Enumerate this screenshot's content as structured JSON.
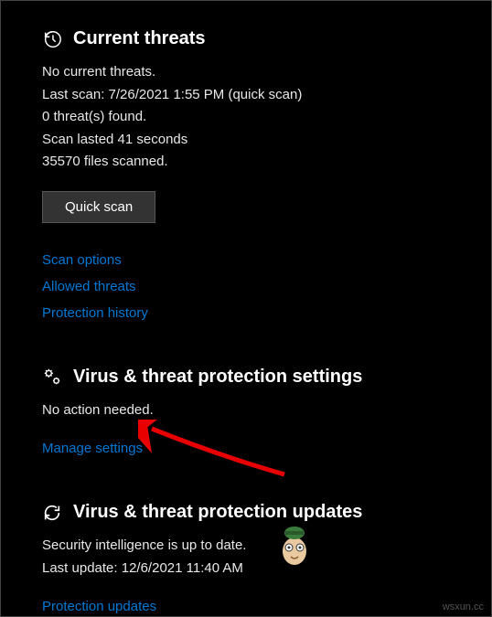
{
  "currentThreats": {
    "title": "Current threats",
    "status": "No current threats.",
    "lastScan": "Last scan: 7/26/2021 1:55 PM (quick scan)",
    "threatsFound": "0 threat(s) found.",
    "scanDuration": "Scan lasted 41 seconds",
    "filesScanned": "35570 files scanned.",
    "quickScanLabel": "Quick scan",
    "scanOptionsLink": "Scan options",
    "allowedThreatsLink": "Allowed threats",
    "protectionHistoryLink": "Protection history"
  },
  "settings": {
    "title": "Virus & threat protection settings",
    "status": "No action needed.",
    "manageLink": "Manage settings"
  },
  "updates": {
    "title": "Virus & threat protection updates",
    "status": "Security intelligence is up to date.",
    "lastUpdate": "Last update: 12/6/2021 11:40 AM",
    "protectionUpdatesLink": "Protection updates"
  },
  "watermark": "wsxun.cc"
}
